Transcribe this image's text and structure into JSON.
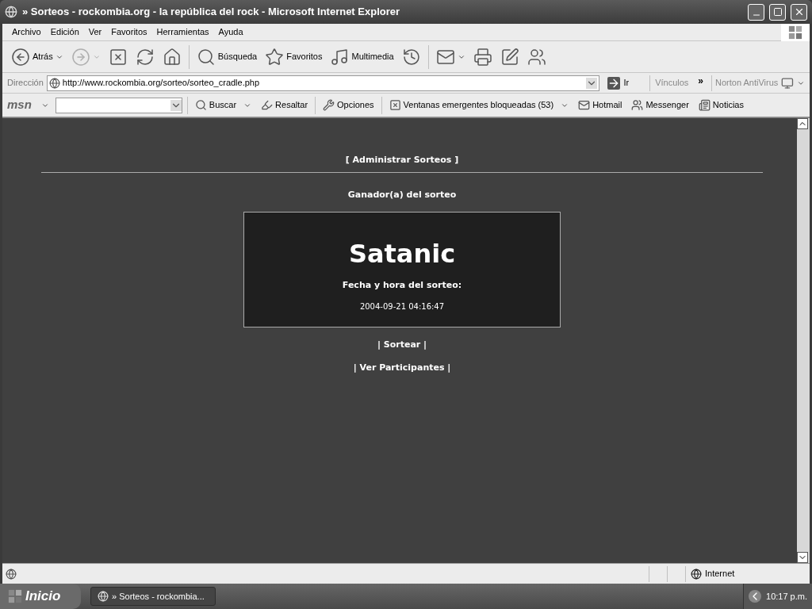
{
  "window": {
    "title": "» Sorteos - rockombia.org - la república del rock - Microsoft Internet Explorer"
  },
  "menu": [
    "Archivo",
    "Edición",
    "Ver",
    "Favoritos",
    "Herramientas",
    "Ayuda"
  ],
  "toolbar": [
    {
      "kind": "back",
      "label": "Atrás",
      "dropdown": true,
      "disabled": false
    },
    {
      "kind": "forward",
      "dropdown": true,
      "disabled": true
    },
    {
      "kind": "stop",
      "disabled": false
    },
    {
      "kind": "refresh",
      "disabled": false
    },
    {
      "kind": "home",
      "disabled": false
    },
    {
      "kind": "separator"
    },
    {
      "kind": "search",
      "label": "Búsqueda",
      "disabled": false
    },
    {
      "kind": "favorites",
      "label": "Favoritos",
      "disabled": false
    },
    {
      "kind": "media",
      "label": "Multimedia",
      "disabled": false
    },
    {
      "kind": "history",
      "disabled": false
    },
    {
      "kind": "separator"
    },
    {
      "kind": "mail",
      "dropdown": true,
      "disabled": false
    },
    {
      "kind": "print",
      "disabled": false
    },
    {
      "kind": "edit",
      "disabled": false
    },
    {
      "kind": "messenger",
      "disabled": false
    }
  ],
  "address_bar": {
    "label": "Dirección",
    "url": "http://www.rockombia.org/sorteo/sorteo_cradle.php",
    "go": "Ir",
    "links": "Vínculos",
    "chevron": "»",
    "norton": "Norton AntiVirus"
  },
  "msn_bar": {
    "logo": "msn",
    "items": [
      {
        "kind": "search",
        "label": "Buscar",
        "dropdown": true
      },
      {
        "kind": "highlight",
        "label": "Resaltar"
      },
      {
        "kind": "options",
        "label": "Opciones"
      },
      {
        "kind": "popups",
        "label": "Ventanas emergentes bloqueadas (53)",
        "dropdown": true
      },
      {
        "kind": "hotmail",
        "label": "Hotmail"
      },
      {
        "kind": "messenger",
        "label": "Messenger"
      },
      {
        "kind": "news",
        "label": "Noticias"
      }
    ]
  },
  "page": {
    "admin_link": "[ Administrar Sorteos ]",
    "heading": "Ganador(a) del sorteo",
    "winner": "Satanic",
    "date_label": "Fecha y hora del sorteo:",
    "date_value": "2004-09-21 04:16:47",
    "links": [
      "| Sortear |",
      "| Ver Participantes |"
    ]
  },
  "status_bar": {
    "zone": "Internet"
  },
  "taskbar": {
    "start": "Inicio",
    "task": "» Sorteos - rockombia...",
    "clock": "10:17 p.m."
  }
}
